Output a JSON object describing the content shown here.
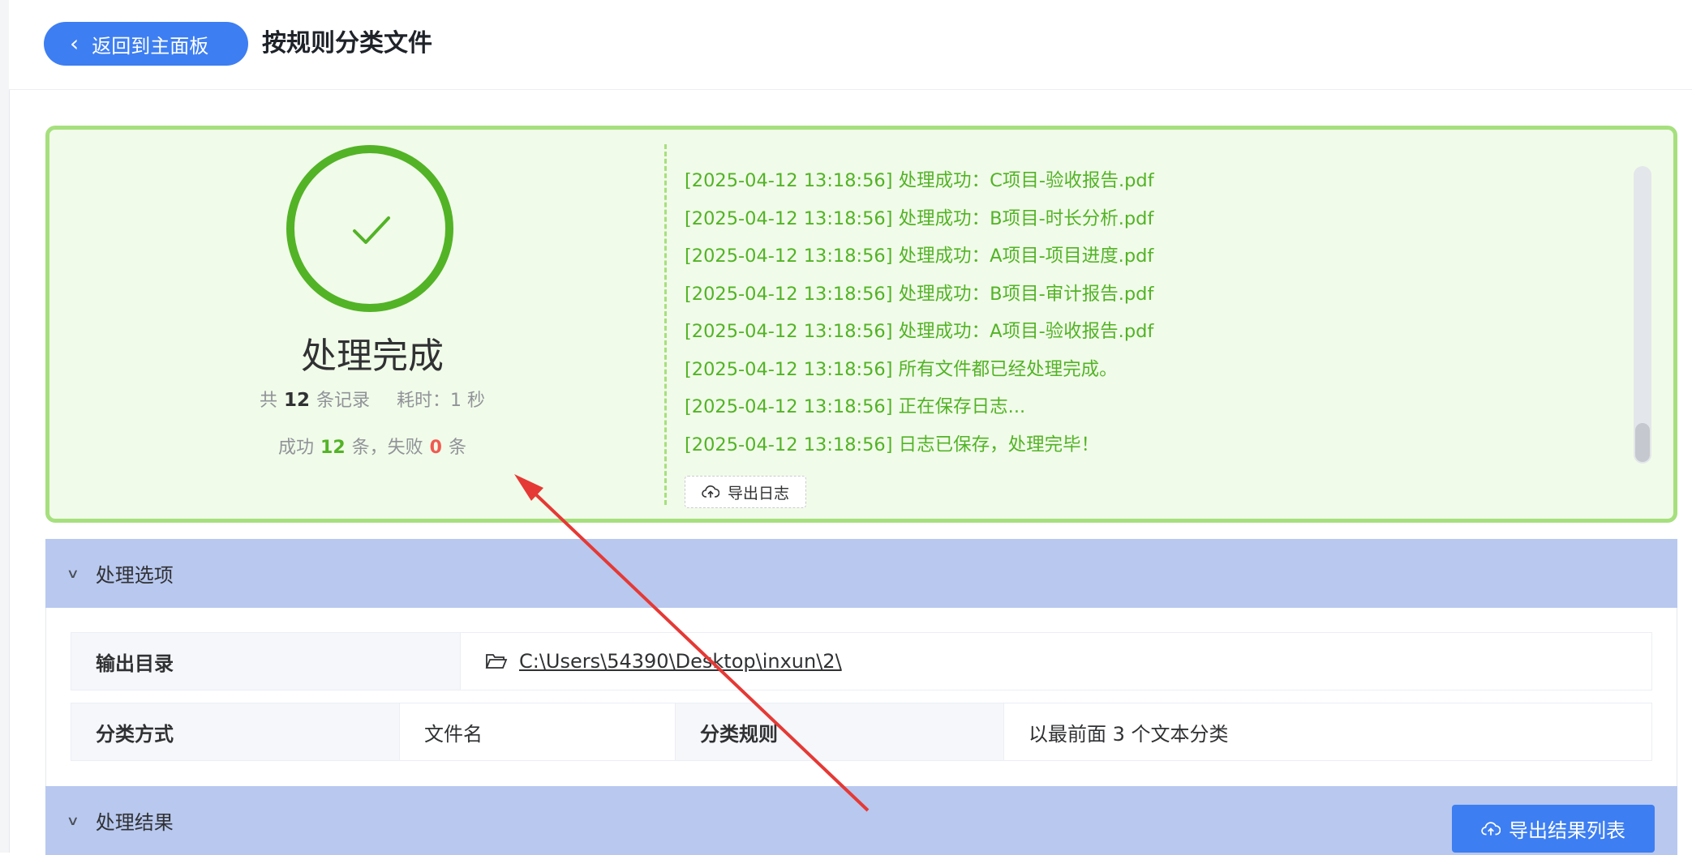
{
  "header": {
    "back_label": "返回到主面板",
    "title": "按规则分类文件"
  },
  "result": {
    "status_title": "处理完成",
    "stat_total_prefix": "共",
    "total": "12",
    "stat_total_suffix": "条记录",
    "time_label": "耗时：1 秒",
    "success_prefix": "成功",
    "success_count": "12",
    "success_suffix": "条，失败",
    "fail_count": "0",
    "fail_suffix": "条",
    "logs": [
      "[2025-04-12 13:18:56] 处理成功：C项目-验收报告.pdf",
      "[2025-04-12 13:18:56] 处理成功：B项目-时长分析.pdf",
      "[2025-04-12 13:18:56] 处理成功：A项目-项目进度.pdf",
      "[2025-04-12 13:18:56] 处理成功：B项目-审计报告.pdf",
      "[2025-04-12 13:18:56] 处理成功：A项目-验收报告.pdf",
      "[2025-04-12 13:18:56] 所有文件都已经处理完成。",
      "[2025-04-12 13:18:56] 正在保存日志...",
      "[2025-04-12 13:18:56] 日志已保存，处理完毕！"
    ],
    "export_log_label": "导出日志"
  },
  "options": {
    "section_title": "处理选项",
    "output_dir_label": "输出目录",
    "output_dir_value": "C:\\Users\\54390\\Desktop\\inxun\\2\\",
    "classify_method_label": "分类方式",
    "classify_method_value": "文件名",
    "classify_rule_label": "分类规则",
    "classify_rule_value": "以最前面 3 个文本分类"
  },
  "results": {
    "section_title": "处理结果",
    "export_label": "导出结果列表"
  },
  "colors": {
    "primary": "#3d7ef2",
    "success": "#52b326",
    "fail": "#f05a50",
    "panel_border": "#a6e07e",
    "panel_bg": "#f1fbe9",
    "section_header": "#b8c8ef",
    "annotation_arrow": "#e53935"
  }
}
